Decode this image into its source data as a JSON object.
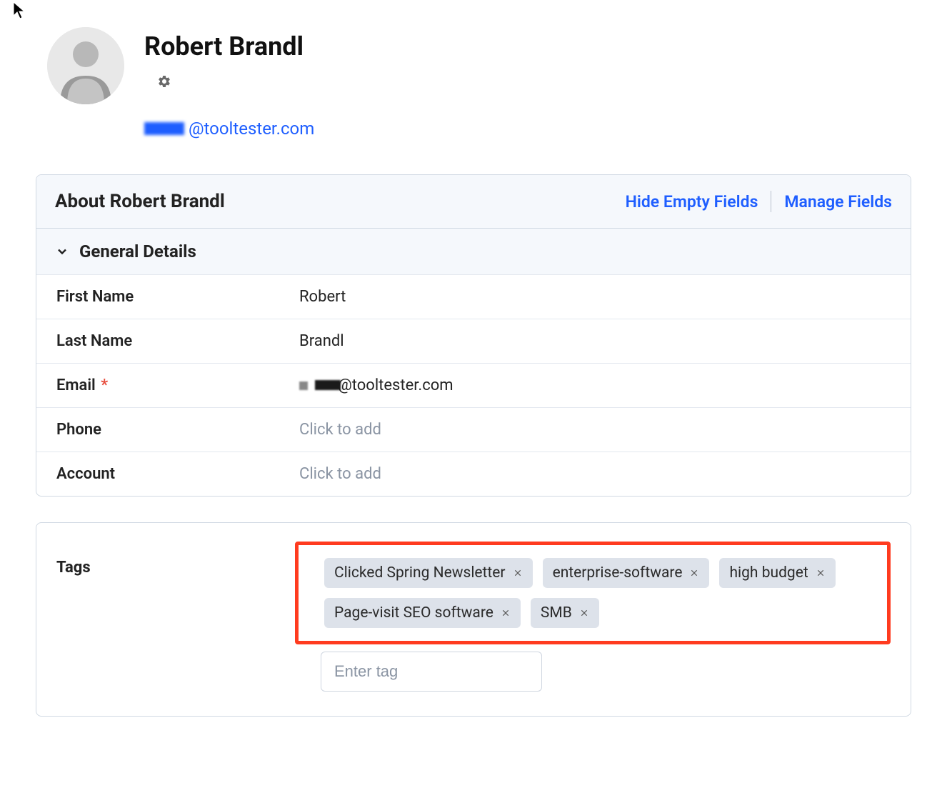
{
  "contact": {
    "name": "Robert Brandl",
    "email_domain": "@tooltester.com"
  },
  "about": {
    "title": "About Robert Brandl",
    "actions": {
      "hide_empty": "Hide Empty Fields",
      "manage": "Manage Fields"
    },
    "section_title": "General Details",
    "fields": {
      "first_name": {
        "label": "First Name",
        "value": "Robert"
      },
      "last_name": {
        "label": "Last Name",
        "value": "Brandl"
      },
      "email": {
        "label": "Email",
        "required": "*",
        "value_domain": "@tooltester.com"
      },
      "phone": {
        "label": "Phone",
        "placeholder": "Click to add"
      },
      "account": {
        "label": "Account",
        "placeholder": "Click to add"
      }
    }
  },
  "tags": {
    "label": "Tags",
    "items": [
      "Clicked Spring Newsletter",
      "enterprise-software",
      "high budget",
      "Page-visit SEO software",
      "SMB"
    ],
    "input_placeholder": "Enter tag"
  }
}
